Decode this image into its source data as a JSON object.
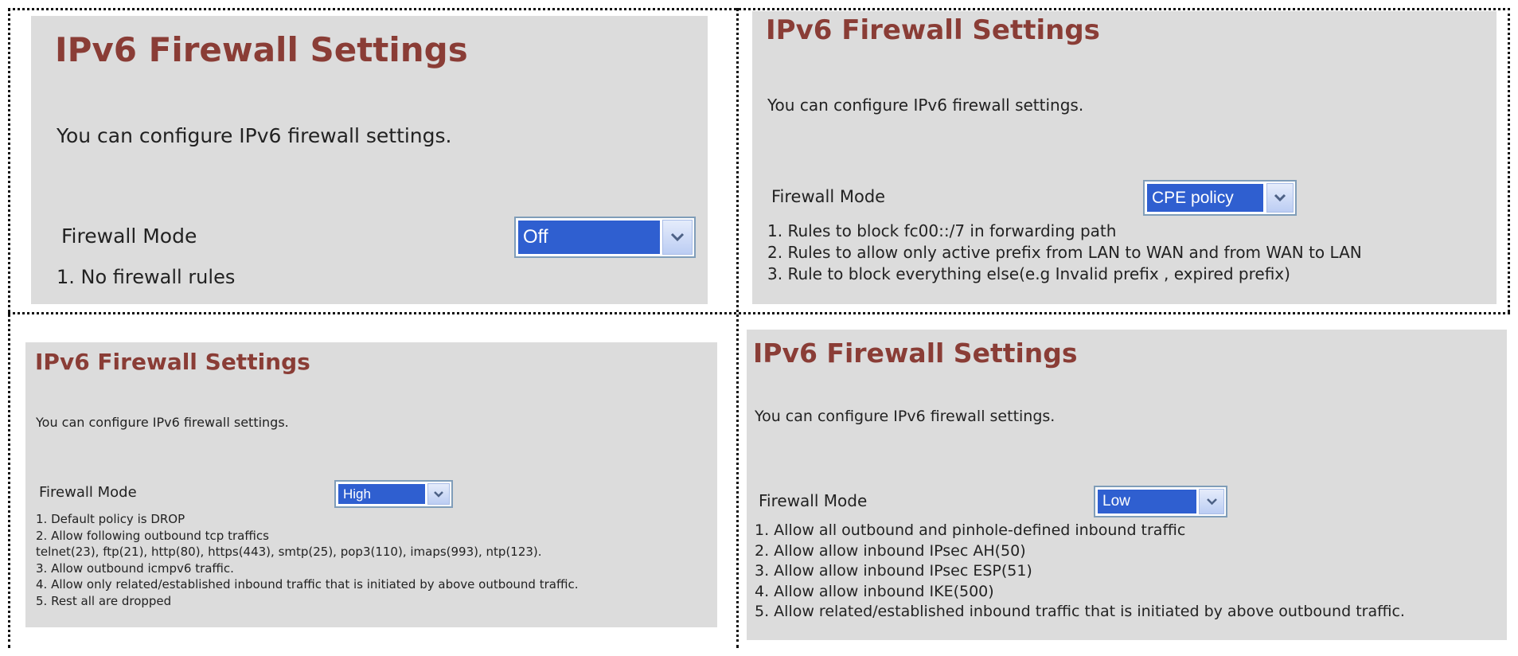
{
  "panels": [
    {
      "title": "IPv6 Firewall Settings",
      "description": "You can configure IPv6 firewall settings.",
      "mode_label": "Firewall Mode",
      "mode_value": "Off",
      "rules": [
        "1. No firewall rules"
      ]
    },
    {
      "title": "IPv6 Firewall Settings",
      "description": "You can configure IPv6 firewall settings.",
      "mode_label": "Firewall Mode",
      "mode_value": "CPE policy",
      "rules": [
        "1. Rules to block fc00::/7 in forwarding path",
        "2. Rules to allow only active prefix from LAN to WAN and from WAN to LAN",
        "3. Rule to block everything else(e.g Invalid prefix , expired prefix)"
      ]
    },
    {
      "title": "IPv6 Firewall Settings",
      "description": "You can configure IPv6 firewall settings.",
      "mode_label": "Firewall Mode",
      "mode_value": "High",
      "rules": [
        "1. Default policy is DROP",
        "2. Allow following outbound tcp traffics",
        "telnet(23), ftp(21), http(80), https(443), smtp(25), pop3(110), imaps(993), ntp(123).",
        "3. Allow outbound icmpv6 traffic.",
        "4. Allow only related/established inbound traffic that is initiated by above outbound traffic.",
        "5. Rest all are dropped"
      ]
    },
    {
      "title": "IPv6 Firewall Settings",
      "description": "You can configure IPv6 firewall settings.",
      "mode_label": "Firewall Mode",
      "mode_value": "Low",
      "rules": [
        "1. Allow all outbound and pinhole-defined inbound traffic",
        "2. Allow allow inbound IPsec AH(50)",
        "3. Allow allow inbound IPsec ESP(51)",
        "4. Allow allow inbound IKE(500)",
        "5. Allow related/established inbound traffic that is initiated by above outbound traffic."
      ]
    }
  ],
  "icons": {
    "dropdown": "chevron-down-icon"
  },
  "colors": {
    "panel_bg": "#dcdcdc",
    "title": "#8a3d36",
    "selection": "#2f5fd0"
  }
}
